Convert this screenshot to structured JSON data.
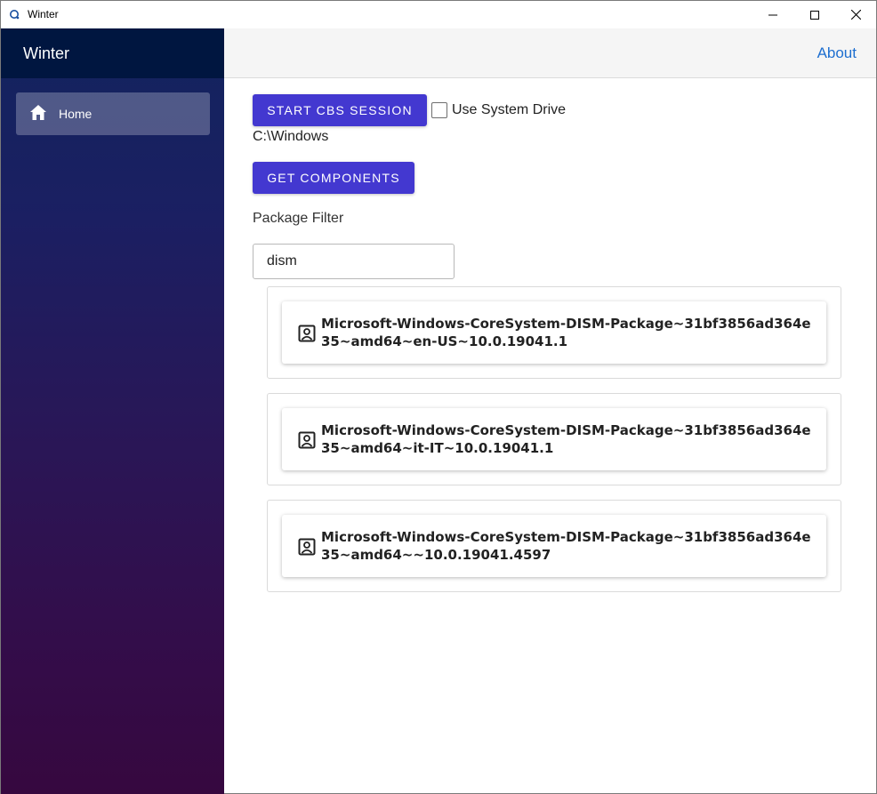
{
  "window": {
    "title": "Winter",
    "controls": [
      "minimize-icon",
      "maximize-icon",
      "close-icon"
    ]
  },
  "sidebar": {
    "title": "Winter",
    "items": [
      {
        "label": "Home",
        "icon": "home-icon",
        "selected": true
      }
    ]
  },
  "topbar": {
    "about_label": "About",
    "about_color": "#1e6fd0"
  },
  "main": {
    "start_button_label": "START CBS SESSION",
    "use_system_drive_label": "Use System Drive",
    "use_system_drive_checked": false,
    "path": "C:\\Windows",
    "get_components_label": "GET COMPONENTS",
    "filter_label": "Package Filter",
    "filter_value": "dism",
    "packages": [
      {
        "name": "Microsoft-Windows-CoreSystem-DISM-Package~31bf3856ad364e35~amd64~en-US~10.0.19041.1",
        "icon": "package-icon"
      },
      {
        "name": "Microsoft-Windows-CoreSystem-DISM-Package~31bf3856ad364e35~amd64~it-IT~10.0.19041.1",
        "icon": "package-icon"
      },
      {
        "name": "Microsoft-Windows-CoreSystem-DISM-Package~31bf3856ad364e35~amd64~~10.0.19041.4597",
        "icon": "package-icon"
      }
    ]
  },
  "colors": {
    "accent": "#4338d0",
    "sidebar_header": "#001640",
    "sidebar_gradient_top": "#12245e",
    "sidebar_gradient_bottom": "#36083f"
  }
}
